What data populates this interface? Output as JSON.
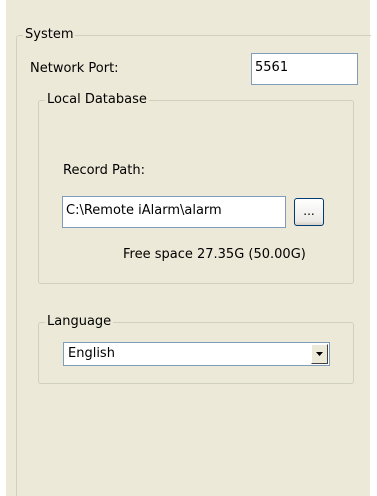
{
  "system": {
    "legend": "System",
    "network_port_label": "Network Port:",
    "network_port_value": "5561"
  },
  "local_database": {
    "legend": "Local Database",
    "record_path_label": "Record Path:",
    "record_path_value": "C:\\Remote iAlarm\\alarm",
    "browse_label": "...",
    "free_space_text": "Free space 27.35G (50.00G)"
  },
  "language": {
    "legend": "Language",
    "selected": "English",
    "dropdown_icon": "chevron-down-icon"
  }
}
